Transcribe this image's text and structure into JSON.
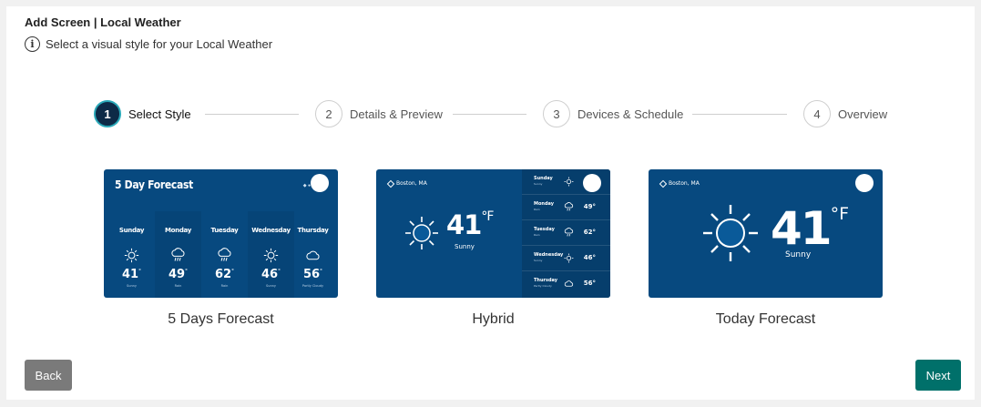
{
  "header": {
    "title": "Add Screen | Local Weather",
    "subtitle": "Select a visual style for your Local Weather",
    "info_icon": "i"
  },
  "stepper": [
    {
      "number": "1",
      "label": "Select Style",
      "active": true
    },
    {
      "number": "2",
      "label": "Details & Preview",
      "active": false
    },
    {
      "number": "3",
      "label": "Devices & Schedule",
      "active": false
    },
    {
      "number": "4",
      "label": "Overview",
      "active": false
    }
  ],
  "styles": [
    {
      "name": "5 Days Forecast",
      "preview": {
        "title": "5 Day Forecast",
        "days": [
          {
            "day": "Sunday",
            "temp": "41",
            "cond": "Sunny",
            "icon": "sun-icon"
          },
          {
            "day": "Monday",
            "temp": "49",
            "cond": "Rain",
            "icon": "rain-icon"
          },
          {
            "day": "Tuesday",
            "temp": "62",
            "cond": "Rain",
            "icon": "rain-icon"
          },
          {
            "day": "Wednesday",
            "temp": "46",
            "cond": "Sunny",
            "icon": "sun-icon"
          },
          {
            "day": "Thursday",
            "temp": "56",
            "cond": "Partly Cloudy",
            "icon": "cloud-icon"
          }
        ]
      }
    },
    {
      "name": "Hybrid",
      "preview": {
        "location": "Boston, MA",
        "temp": "41",
        "unit": "°F",
        "cond": "Sunny",
        "rows": [
          {
            "day": "Sunday",
            "cond": "Sunny",
            "temp": "",
            "icon": "sun-icon"
          },
          {
            "day": "Monday",
            "cond": "Rain",
            "temp": "49",
            "icon": "rain-icon"
          },
          {
            "day": "Tuesday",
            "cond": "Rain",
            "temp": "62",
            "icon": "rain-icon"
          },
          {
            "day": "Wednesday",
            "cond": "Sunny",
            "temp": "46",
            "icon": "sun-icon"
          },
          {
            "day": "Thursday",
            "cond": "Partly Cloudy",
            "temp": "56",
            "icon": "cloud-icon"
          }
        ]
      }
    },
    {
      "name": "Today Forecast",
      "preview": {
        "location": "Boston, MA",
        "temp": "41",
        "unit": "°F",
        "cond": "Sunny"
      }
    }
  ],
  "buttons": {
    "back": "Back",
    "next": "Next"
  },
  "colors": {
    "card_bg": "#07497f",
    "active_step": "#0d2a47",
    "active_ring": "#2aa8b8",
    "next_btn": "#00706a",
    "back_btn": "#7a7a7a"
  }
}
